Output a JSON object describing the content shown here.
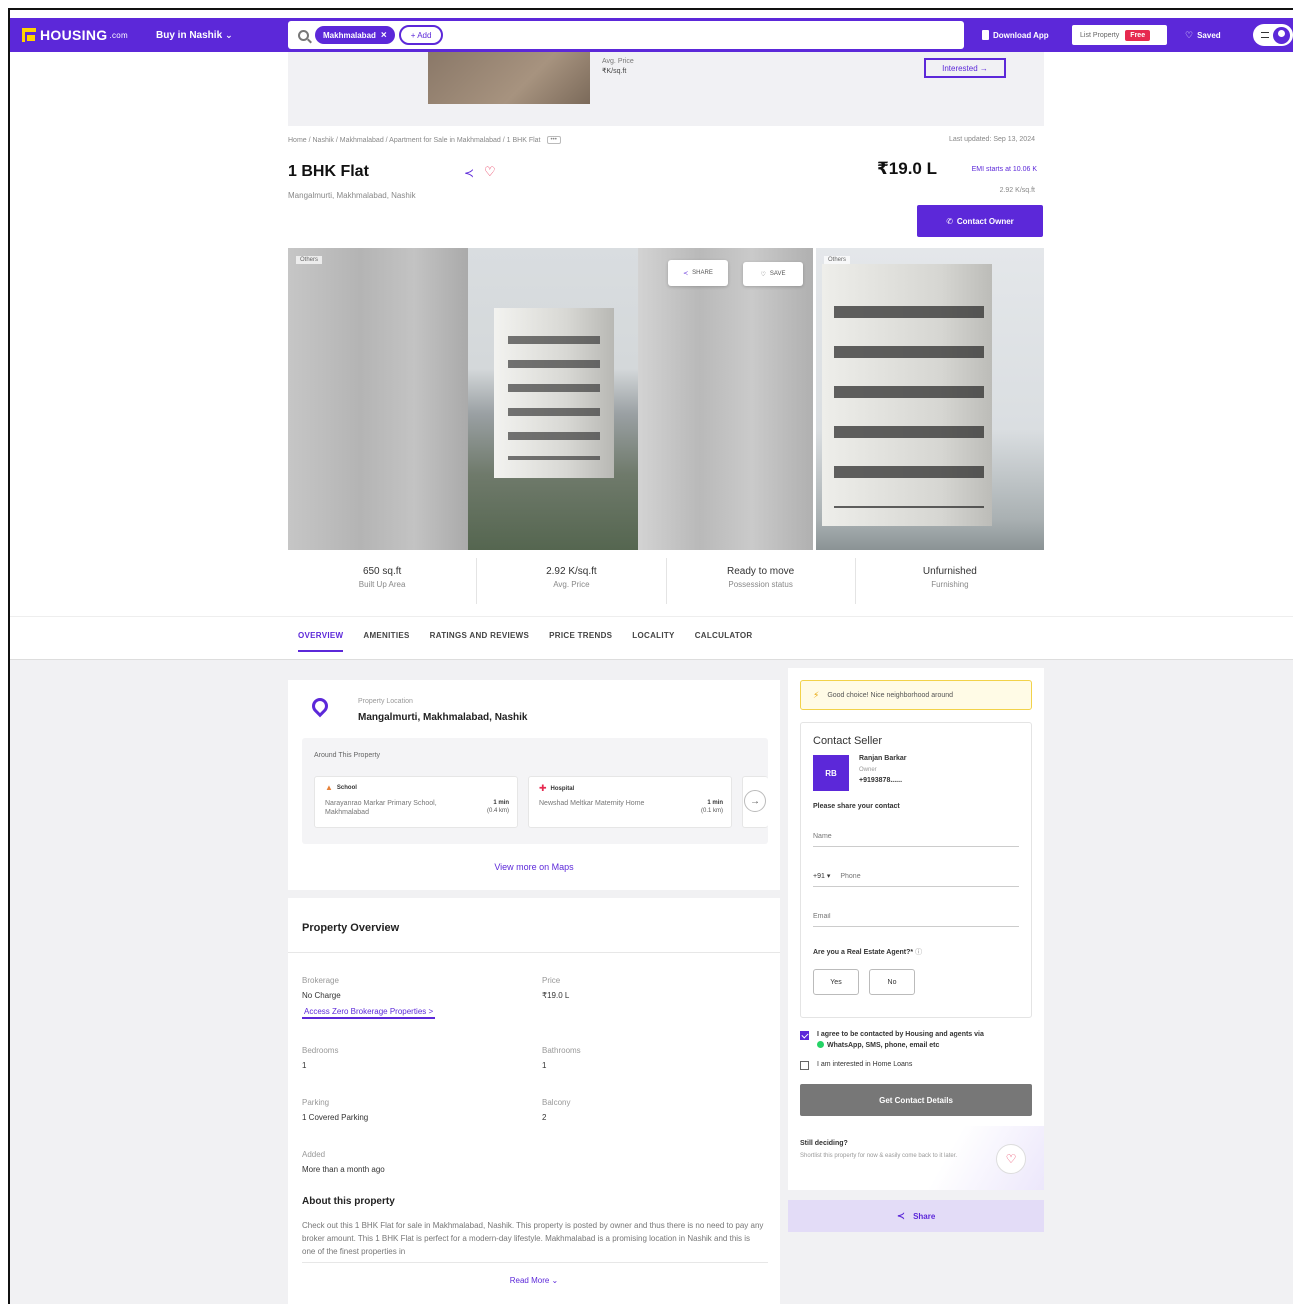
{
  "header": {
    "logo_text": "HOUSING",
    "logo_suffix": ".com",
    "buy_in": "Buy in Nashik",
    "search_chip": "Makhmalabad",
    "add_chip": "+ Add",
    "download_app": "Download App",
    "list_property": "List Property",
    "free_badge": "Free",
    "saved": "Saved"
  },
  "top_strip": {
    "avg_price_label": "Avg. Price",
    "avg_price_value": "₹K/sq.ft",
    "interested": "Interested →"
  },
  "listing": {
    "breadcrumb": "Home / Nashik / Makhmalabad / Apartment for Sale in Makhmalabad / 1 BHK Flat",
    "more": "•••",
    "last_updated": "Last updated: Sep 13, 2024",
    "title": "1 BHK Flat",
    "location": "Mangalmurti, Makhmalabad, Nashik",
    "price": "₹19.0 L",
    "emi": "EMI starts at 10.06 K",
    "price_per_sqft": "2.92 K/sq.ft",
    "contact_owner": "Contact Owner"
  },
  "gallery": {
    "tag_left": "Others",
    "tag_right": "Others",
    "share": "SHARE",
    "save": "SAVE"
  },
  "stats": [
    {
      "value": "650 sq.ft",
      "label": "Built Up Area"
    },
    {
      "value": "2.92 K/sq.ft",
      "label": "Avg. Price"
    },
    {
      "value": "Ready to move",
      "label": "Possession status"
    },
    {
      "value": "Unfurnished",
      "label": "Furnishing"
    }
  ],
  "tabs": [
    "OVERVIEW",
    "AMENITIES",
    "RATINGS AND REVIEWS",
    "PRICE TRENDS",
    "LOCALITY",
    "CALCULATOR"
  ],
  "location_card": {
    "label": "Property Location",
    "address": "Mangalmurti, Makhmalabad, Nashik",
    "around_title": "Around This Property",
    "pois": [
      {
        "type": "School",
        "name": "Narayanrao Markar Primary School, Makhmalabad",
        "dist_time": "1 min",
        "dist_km": "(0.4 km)"
      },
      {
        "type": "Hospital",
        "name": "Newshad Meltkar Maternity Home",
        "dist_time": "1 min",
        "dist_km": "(0.1 km)"
      }
    ],
    "view_maps": "View more on Maps"
  },
  "overview": {
    "title": "Property Overview",
    "brokerage_label": "Brokerage",
    "brokerage_value": "No Charge",
    "brokerage_link": "Access Zero Brokerage Properties >",
    "price_label": "Price",
    "price_value": "₹19.0 L",
    "bedrooms_label": "Bedrooms",
    "bedrooms_value": "1",
    "bathrooms_label": "Bathrooms",
    "bathrooms_value": "1",
    "parking_label": "Parking",
    "parking_value": "1 Covered Parking",
    "balcony_label": "Balcony",
    "balcony_value": "2",
    "added_label": "Added",
    "added_value": "More than a month ago",
    "about_title": "About this property",
    "about_text": "Check out this 1 BHK Flat for sale in Makhmalabad, Nashik. This property is posted by owner and thus there is no need to pay any broker amount. This 1 BHK Flat is perfect for a modern-day lifestyle. Makhmalabad is a promising location in Nashik and this is one of the finest properties in",
    "read_more": "Read More ⌄"
  },
  "sidebar": {
    "good_choice": "Good choice! Nice neighborhood around",
    "contact_title": "Contact Seller",
    "avatar_initials": "RB",
    "seller_name": "Ranjan Barkar",
    "seller_role": "Owner",
    "seller_phone": "+9193878......",
    "share_contact": "Please share your contact",
    "name_placeholder": "Name",
    "country_code": "+91 ▾",
    "phone_placeholder": "Phone",
    "email_placeholder": "Email",
    "agent_question": "Are you a Real Estate Agent?*",
    "yes": "Yes",
    "no": "No",
    "consent_line1": "I agree to be contacted by Housing and agents via",
    "consent_line2": "WhatsApp, SMS, phone, email etc",
    "home_loans": "I am interested in Home Loans",
    "get_details": "Get Contact Details",
    "still_title": "Still deciding?",
    "still_text": "Shortlist this property for now & easily come back to it later.",
    "share": "Share"
  },
  "colors": {
    "brand": "#5c28d9",
    "accent_red": "#e6294f"
  }
}
